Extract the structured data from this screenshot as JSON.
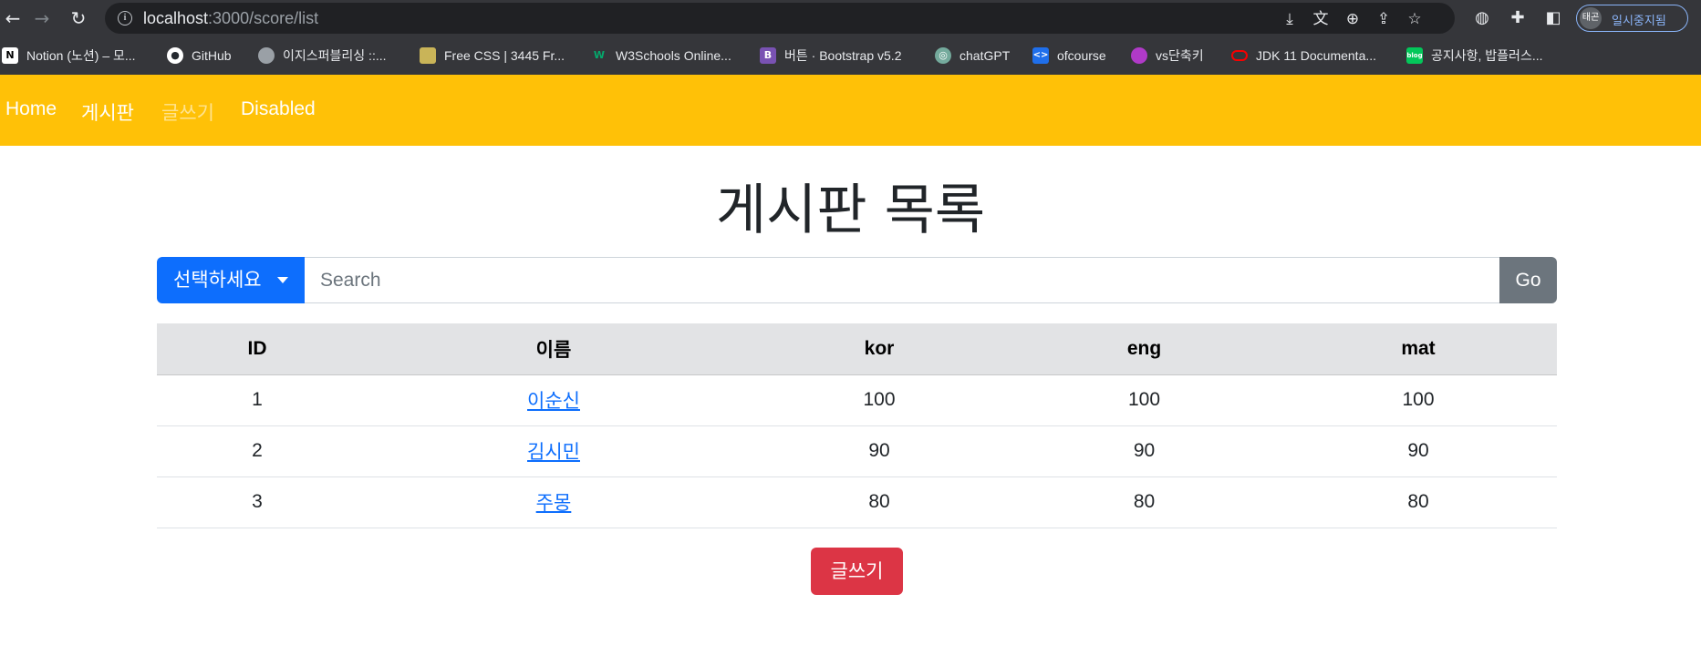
{
  "browser": {
    "url_host": "localhost",
    "url_path": ":3000/score/list",
    "profile_initials": "태곤",
    "profile_label": "일시중지됨",
    "bookmarks": [
      {
        "label": "Notion (노션) – 모...",
        "icon": "notion-icon",
        "color": "#ffffff"
      },
      {
        "label": "GitHub",
        "icon": "github-icon",
        "color": "#ffffff"
      },
      {
        "label": "이지스퍼블리싱 ::...",
        "icon": "globe-icon",
        "color": "#9aa0a6"
      },
      {
        "label": "Free CSS | 3445 Fr...",
        "icon": "freecss-icon",
        "color": "#c9b458"
      },
      {
        "label": "W3Schools Online...",
        "icon": "w3schools-icon",
        "color": "#04aa6d"
      },
      {
        "label": "버튼 · Bootstrap v5.2",
        "icon": "bootstrap-icon",
        "color": "#7952b3"
      },
      {
        "label": "chatGPT",
        "icon": "chatgpt-icon",
        "color": "#74aa9c"
      },
      {
        "label": "ofcourse",
        "icon": "code-icon",
        "color": "#1f6feb"
      },
      {
        "label": "vs단축키",
        "icon": "vs-icon",
        "color": "#b03ac8"
      },
      {
        "label": "JDK 11 Documenta...",
        "icon": "oracle-icon",
        "color": "#f80000"
      },
      {
        "label": "공지사항, 밥플러스...",
        "icon": "blog-icon",
        "color": "#03c75a"
      }
    ]
  },
  "navbar": {
    "links": [
      "Home",
      "게시판",
      "글쓰기",
      "Disabled"
    ],
    "background": "#ffc107"
  },
  "page": {
    "title": "게시판 목록",
    "dropdown_label": "선택하세요",
    "search_placeholder": "Search",
    "go_label": "Go",
    "write_label": "글쓰기"
  },
  "table": {
    "headers": [
      "ID",
      "이름",
      "kor",
      "eng",
      "mat"
    ],
    "rows": [
      {
        "id": "1",
        "name": "이순신",
        "kor": "100",
        "eng": "100",
        "mat": "100"
      },
      {
        "id": "2",
        "name": "김시민",
        "kor": "90",
        "eng": "90",
        "mat": "90"
      },
      {
        "id": "3",
        "name": "주몽",
        "kor": "80",
        "eng": "80",
        "mat": "80"
      }
    ]
  },
  "colors": {
    "primary": "#0d6efd",
    "secondary": "#6c757d",
    "danger": "#dc3545",
    "warning": "#ffc107"
  }
}
